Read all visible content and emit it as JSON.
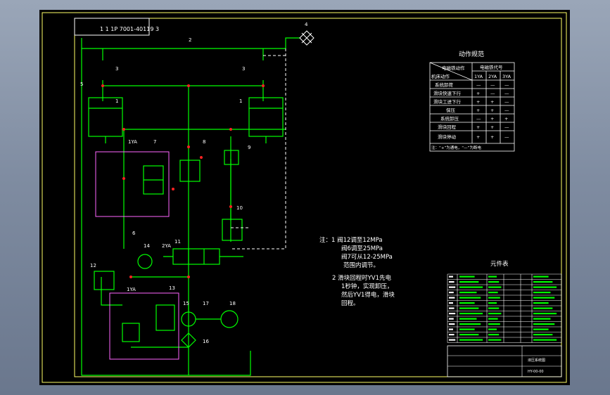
{
  "title_strip": "1  1  1P  7001-40119  3",
  "numbers": {
    "n1a": "1",
    "n1b": "1",
    "n2": "2",
    "n3a": "3",
    "n3b": "3",
    "n4": "4",
    "n5": "5",
    "n6": "6",
    "n7": "7",
    "n8": "8",
    "n9": "9",
    "n10": "10",
    "n11": "11",
    "n12": "12",
    "n13": "13",
    "n14": "14",
    "n15": "15",
    "n16": "16",
    "n17": "17",
    "n18": "18",
    "yv1a": "1YA",
    "yv1b": "1YA",
    "yv2": "2YA"
  },
  "action_table": {
    "title": "动作规范",
    "col_header_top": "电磁铁代号",
    "corner_top": "电磁铁动作",
    "corner_bottom": "机床动作",
    "cols": [
      "1YA",
      "2YA",
      "3YA"
    ],
    "rows": [
      {
        "action": "系统卸荷",
        "marks": [
          "—",
          "—",
          "—"
        ]
      },
      {
        "action": "滑块快速下行",
        "marks": [
          "+",
          "—",
          "—"
        ]
      },
      {
        "action": "滑块工进下行",
        "marks": [
          "+",
          "+",
          "—"
        ]
      },
      {
        "action": "保压",
        "marks": [
          "+",
          "+",
          "—"
        ]
      },
      {
        "action": "系统卸压",
        "marks": [
          "—",
          "+",
          "+"
        ]
      },
      {
        "action": "滑块回程",
        "marks": [
          "+",
          "+",
          "—"
        ]
      },
      {
        "action": "滑块停动",
        "marks": [
          "+",
          "+",
          "—"
        ]
      }
    ],
    "footnote": "注：“+”为通电，“—”为断电"
  },
  "notes": {
    "lines": [
      "注：1  阀12调至12MPa",
      "阀6调至25MPa",
      "阀7可从12-25MPa",
      "范围内调节。",
      "2  滑块回程时YV1先电",
      "1秒钟，实现卸压，",
      "然后YV1得电，滑块",
      "回程。"
    ]
  },
  "parts_table": {
    "title": "元件表",
    "rows": 13,
    "footer_label": "液压系统图",
    "footer_code": "HY-00-00"
  }
}
